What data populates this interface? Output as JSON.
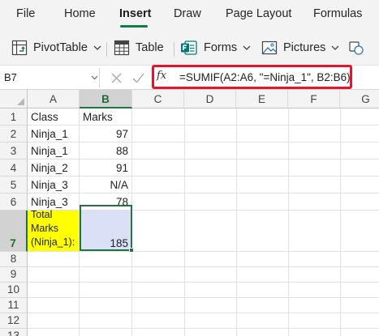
{
  "ribbon": {
    "tabs": [
      {
        "label": "File"
      },
      {
        "label": "Home"
      },
      {
        "label": "Insert",
        "active": true
      },
      {
        "label": "Draw"
      },
      {
        "label": "Page Layout"
      },
      {
        "label": "Formulas"
      }
    ],
    "commands": {
      "pivottable": "PivotTable",
      "table": "Table",
      "forms": "Forms",
      "pictures": "Pictures"
    }
  },
  "formula_bar": {
    "name_box": "B7",
    "fx_label": "fx",
    "formula": "=SUMIF(A2:A6, \"=Ninja_1\", B2:B6)"
  },
  "sheet": {
    "columns": [
      "A",
      "B",
      "C",
      "D",
      "E",
      "F",
      "G"
    ],
    "selected_column": "B",
    "rows": [
      "1",
      "2",
      "3",
      "4",
      "5",
      "6",
      "7",
      "8",
      "9",
      "10",
      "11",
      "12",
      "13"
    ],
    "selected_row": "7",
    "cells": {
      "A1": "Class",
      "B1": "Marks",
      "A2": "Ninja_1",
      "B2": "97",
      "A3": "Ninja_1",
      "B3": "88",
      "A4": "Ninja_2",
      "B4": "91",
      "A5": "Ninja_3",
      "B5": "N/A",
      "A6": "Ninja_3",
      "B6": "78",
      "A7": "Total Marks (Ninja_1):",
      "B7": "185"
    }
  },
  "colors": {
    "accent": "#217346",
    "highlight_box": "#e8132b",
    "total_label_fill": "#ffff00",
    "total_value_fill": "#dae0f5"
  },
  "icons": [
    "pivottable-icon",
    "table-icon",
    "forms-icon",
    "pictures-icon",
    "shapes-icon",
    "cancel-icon",
    "enter-icon",
    "chevron-down-icon",
    "select-all-icon"
  ]
}
